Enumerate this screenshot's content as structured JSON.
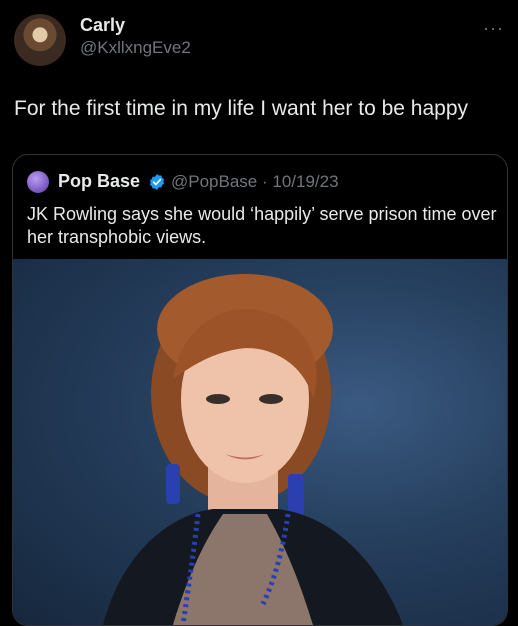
{
  "author": {
    "name": "Carly",
    "handle": "@KxllxngEve2"
  },
  "tweet": {
    "text": "For the first time in my life I want her to be happy"
  },
  "quoted": {
    "name": "Pop Base",
    "meta": "@PopBase · 10/19/23",
    "text": "JK Rowling says she would ‘happily’ serve prison time over her transphobic views."
  },
  "icons": {
    "more": "more-dots-icon",
    "verified": "verified-badge-icon"
  },
  "colors": {
    "background": "#000000",
    "text": "#e7e9ea",
    "muted": "#71767b",
    "verified": "#1d9bf0"
  }
}
